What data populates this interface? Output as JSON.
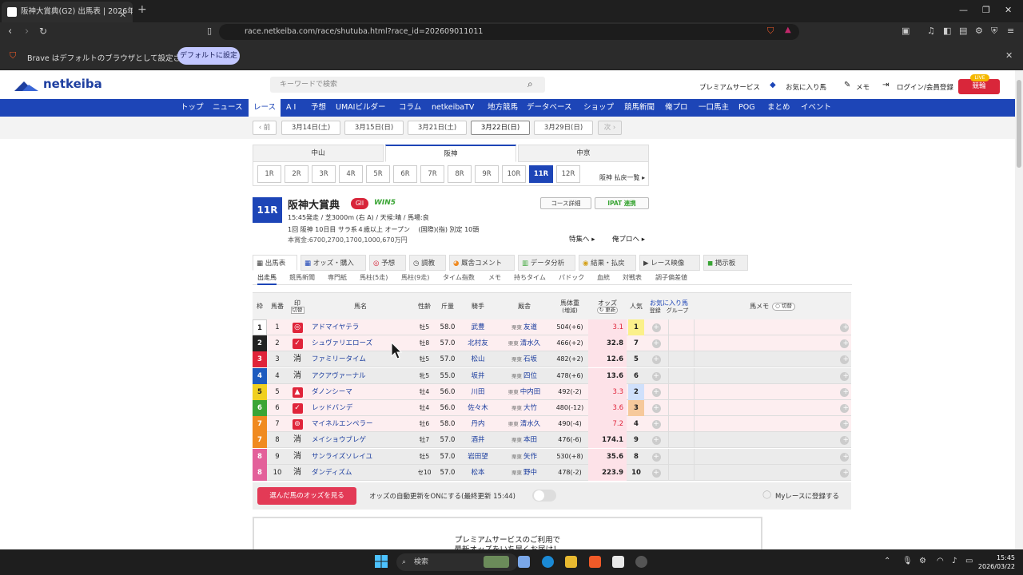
{
  "browser": {
    "tab_title": "阪神大賞典(G2) 出馬表 | 2026年",
    "tab_close": "✕",
    "new_tab": "+",
    "url": "race.netkeiba.com/race/shutuba.html?race_id=202609011011",
    "infobar_text": "Brave はデフォルトのブラウザとして設定されていません",
    "infobar_button": "デフォルトに設定"
  },
  "header": {
    "logo": "netkeiba",
    "search_placeholder": "キーワードで検索",
    "links": [
      "プレミアムサービス",
      "お気に入り馬",
      "メモ",
      "ログイン/会員登録"
    ],
    "live_badge": "LIVE",
    "live_button": "競輪"
  },
  "main_nav": [
    "トップ",
    "ニュース",
    "レース",
    "A I",
    "予想",
    "UMAIビルダー",
    "コラム",
    "netkeibaTV",
    "地方競馬",
    "データベース",
    "ショップ",
    "競馬新聞",
    "俺プロ",
    "一口馬主",
    "POG",
    "まとめ",
    "イベント"
  ],
  "main_nav_active": "レース",
  "dates": {
    "prev": "‹ 前",
    "items": [
      "3月14日(土)",
      "3月15日(日)",
      "3月21日(土)",
      "3月22日(日)",
      "3月29日(日)"
    ],
    "active": "3月22日(日)",
    "next": "次 ›"
  },
  "venues": [
    "中山",
    "阪神",
    "中京"
  ],
  "venue_active": "阪神",
  "races": [
    "1R",
    "2R",
    "3R",
    "4R",
    "5R",
    "6R",
    "7R",
    "8R",
    "9R",
    "10R",
    "11R",
    "12R"
  ],
  "race_active": "11R",
  "payout_link": "阪神 払戻一覧 ▸",
  "race": {
    "number": "11R",
    "name": "阪神大賞典",
    "grade": "GII",
    "win5": "WIN5",
    "line1": "15:45発走 / 芝3000m (右 A) / 天候:晴 / 馬場:良",
    "line2": "1回 阪神 10日目 サラ系４歳以上 オープン　 (国際)(指) 別定 10頭",
    "line3": "本賞金:6700,2700,1700,1000,670万円",
    "course_btn": "コース詳細",
    "ipat_btn": "IPAT 連携",
    "feature_link": "特集へ ▸",
    "orepro_link": "俺プロへ ▸"
  },
  "subtabs": [
    "出馬表",
    "オッズ・購入",
    "予想",
    "調教",
    "厩舎コメント",
    "データ分析",
    "結果・払戻",
    "レース映像",
    "掲示板"
  ],
  "subtab_active": "出馬表",
  "subsubtabs": [
    "出走馬",
    "競馬新聞",
    "専門紙",
    "馬柱(5走)",
    "馬柱(9走)",
    "タイム指数",
    "メモ",
    "持ちタイム",
    "パドック",
    "血統",
    "対戦表",
    "調子偏差値"
  ],
  "table": {
    "headers": {
      "waku": "枠",
      "umaban": "馬番",
      "mark": "印",
      "mark_sub": "切替",
      "name": "馬名",
      "sexage": "性齢",
      "kinryo": "斤量",
      "jockey": "騎手",
      "trainer": "厩舎",
      "weight": "馬体重",
      "weight_sub": "(増減)",
      "odds": "オッズ",
      "odds_sub": "更新",
      "pop": "人気",
      "fav": "お気に入り馬",
      "fav_reg": "登録",
      "fav_group": "グループ",
      "memo": "馬メモ",
      "memo_sub": "切替"
    },
    "rows": [
      {
        "waku": "1",
        "umaban": "1",
        "mark": "◎",
        "name": "アドマイヤテラ",
        "sexage": "牡5",
        "kinryo": "58.0",
        "jockey": "武豊",
        "region": "栗東",
        "trainer": "友道",
        "weight": "504(+6)",
        "odds": "3.1",
        "pop": "1"
      },
      {
        "waku": "2",
        "umaban": "2",
        "mark": "✓",
        "name": "シュヴァリエローズ",
        "sexage": "牡8",
        "kinryo": "57.0",
        "jockey": "北村友",
        "region": "栗東",
        "trainer": "清水久",
        "weight": "466(+2)",
        "odds": "32.8",
        "pop": "7"
      },
      {
        "waku": "3",
        "umaban": "3",
        "mark": "消",
        "name": "ファミリータイム",
        "sexage": "牡5",
        "kinryo": "57.0",
        "jockey": "松山",
        "region": "栗東",
        "trainer": "石坂",
        "weight": "482(+2)",
        "odds": "12.6",
        "pop": "5"
      },
      {
        "waku": "4",
        "umaban": "4",
        "mark": "消",
        "name": "アクアヴァーナル",
        "sexage": "牝5",
        "kinryo": "55.0",
        "jockey": "坂井",
        "region": "栗東",
        "trainer": "四位",
        "weight": "478(+6)",
        "odds": "13.6",
        "pop": "6"
      },
      {
        "waku": "5",
        "umaban": "5",
        "mark": "▲",
        "name": "ダノンシーマ",
        "sexage": "牡4",
        "kinryo": "56.0",
        "jockey": "川田",
        "region": "栗東",
        "trainer": "中内田",
        "weight": "492(-2)",
        "odds": "3.3",
        "pop": "2"
      },
      {
        "waku": "6",
        "umaban": "6",
        "mark": "✓",
        "name": "レッドバンデ",
        "sexage": "牡4",
        "kinryo": "56.0",
        "jockey": "佐々木",
        "region": "栗東",
        "trainer": "大竹",
        "weight": "480(-12)",
        "odds": "3.6",
        "pop": "3"
      },
      {
        "waku": "7",
        "umaban": "7",
        "mark": "⊚",
        "name": "マイネルエンペラー",
        "sexage": "牡6",
        "kinryo": "58.0",
        "jockey": "丹内",
        "region": "栗東",
        "trainer": "清水久",
        "weight": "490(-4)",
        "odds": "7.2",
        "pop": "4"
      },
      {
        "waku": "7",
        "umaban": "8",
        "mark": "消",
        "name": "メイショウブレゲ",
        "sexage": "牡7",
        "kinryo": "57.0",
        "jockey": "酒井",
        "region": "栗東",
        "trainer": "本田",
        "weight": "476(-6)",
        "odds": "174.1",
        "pop": "9"
      },
      {
        "waku": "8",
        "umaban": "9",
        "mark": "消",
        "name": "サンライズソレイユ",
        "sexage": "牡5",
        "kinryo": "57.0",
        "jockey": "岩田望",
        "region": "栗東",
        "trainer": "矢作",
        "weight": "530(+8)",
        "odds": "35.6",
        "pop": "8"
      },
      {
        "waku": "8",
        "umaban": "10",
        "mark": "消",
        "name": "ダンディズム",
        "sexage": "セ10",
        "kinryo": "57.0",
        "jockey": "松本",
        "region": "栗東",
        "trainer": "野中",
        "weight": "478(-2)",
        "odds": "223.9",
        "pop": "10"
      }
    ]
  },
  "footer_bar": {
    "odds_button": "選んだ馬のオッズを見る",
    "auto_update": "オッズの自動更新をONにする(最終更新 15:44)",
    "myrace": "Myレースに登録する"
  },
  "premium": {
    "line1": "プレミアムサービスのご利用で",
    "line2": "最新オッズをいち早くお届け！"
  },
  "taskbar": {
    "search": "検索",
    "time": "15:45",
    "date": "2026/03/22"
  },
  "colors": {
    "accent": "#1d45b7",
    "waku": [
      "#ffffff",
      "#222222",
      "#e0243a",
      "#1d5bbf",
      "#f0d020",
      "#3aa535",
      "#f08a20",
      "#f08a20",
      "#e3609a",
      "#e3609a"
    ]
  }
}
